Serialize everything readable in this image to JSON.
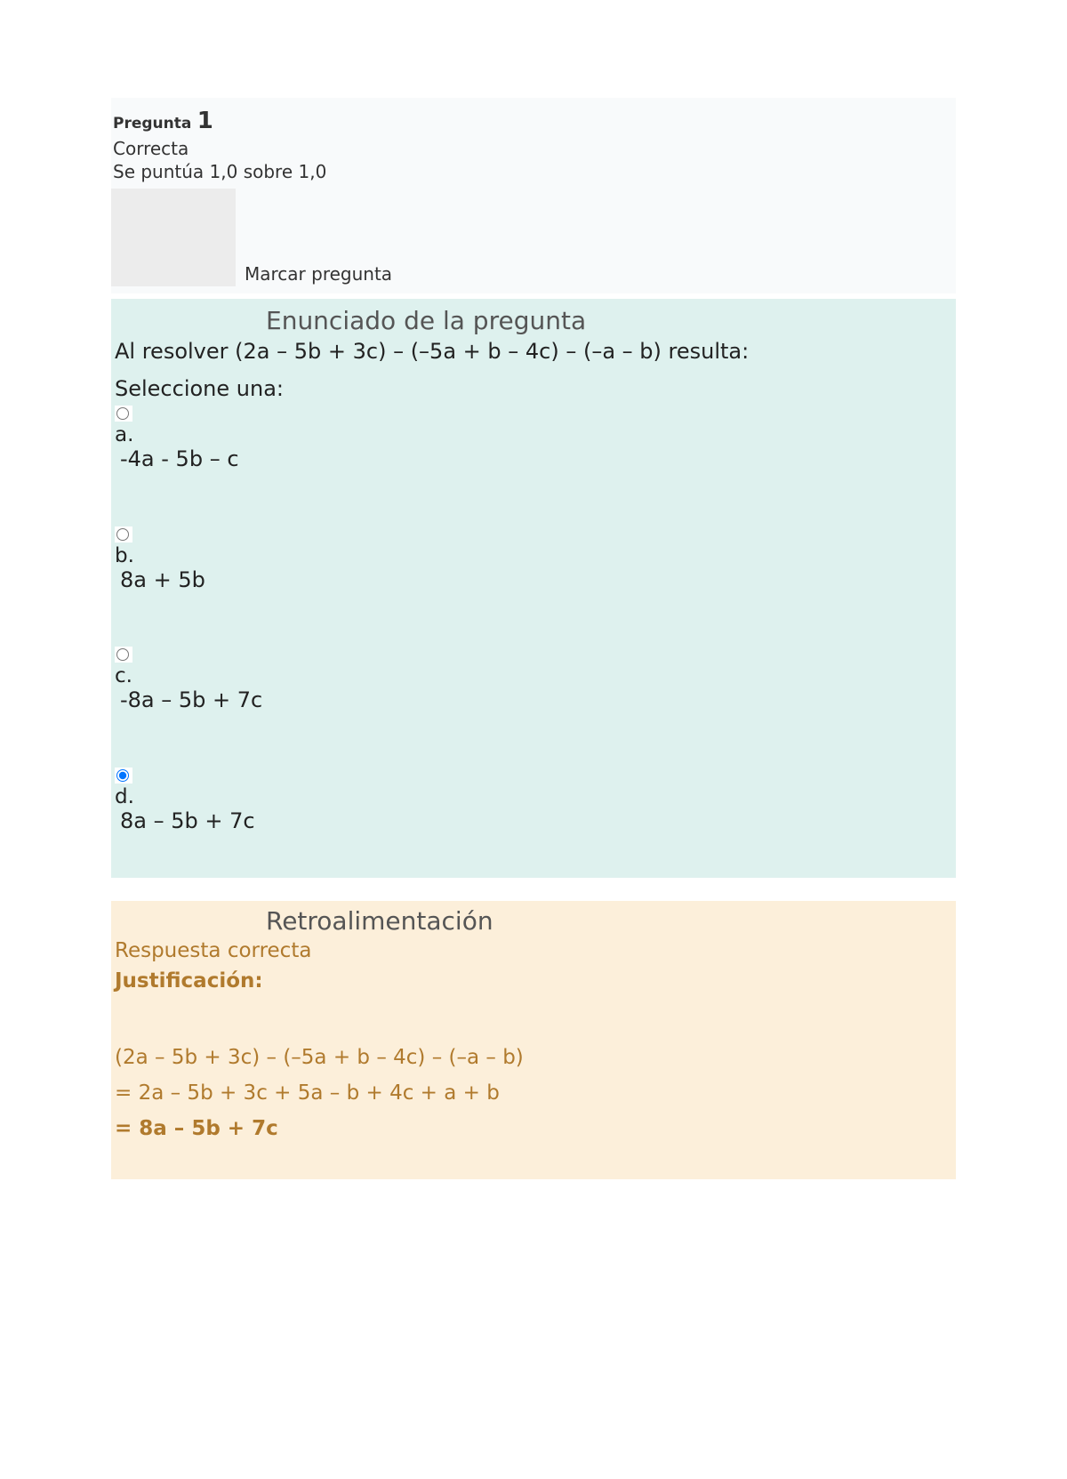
{
  "info": {
    "question_label": "Pregunta",
    "question_number": "1",
    "status": "Correcta",
    "score_line": "Se puntúa 1,0 sobre 1,0",
    "flag_text": "Marcar pregunta"
  },
  "question": {
    "heading": "Enunciado de la pregunta",
    "stem": "Al resolver (2a – 5b + 3c) – (–5a + b – 4c) – (–a – b) resulta:",
    "select_one": "Seleccione una:",
    "options": [
      {
        "letter": "a.",
        "text": " -4a - 5b – c",
        "checked": false
      },
      {
        "letter": "b.",
        "text": " 8a + 5b",
        "checked": false
      },
      {
        "letter": "c.",
        "text": " -8a – 5b + 7c",
        "checked": false
      },
      {
        "letter": "d.",
        "text": "  8a – 5b + 7c",
        "checked": true
      }
    ]
  },
  "feedback": {
    "heading": "Retroalimentación",
    "correct": "Respuesta correcta",
    "just_label": "Justificación:",
    "lines": [
      "(2a – 5b + 3c) – (–5a + b – 4c) – (–a – b)",
      "= 2a – 5b + 3c + 5a – b + 4c + a + b",
      "= 8a – 5b + 7c"
    ]
  }
}
